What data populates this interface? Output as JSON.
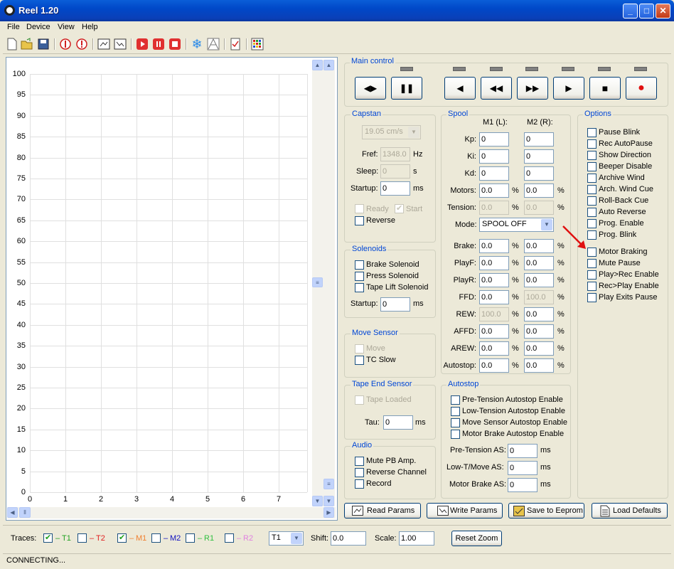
{
  "window": {
    "title": "Reel 1.20"
  },
  "menu": [
    "File",
    "Device",
    "View",
    "Help"
  ],
  "graph": {
    "y_ticks": [
      "100",
      "95",
      "90",
      "85",
      "80",
      "75",
      "70",
      "65",
      "60",
      "55",
      "50",
      "45",
      "40",
      "35",
      "30",
      "25",
      "20",
      "15",
      "10",
      "5",
      "0"
    ],
    "x_ticks": [
      "0",
      "1",
      "2",
      "3",
      "4",
      "5",
      "6",
      "7"
    ]
  },
  "main_control": {
    "title": "Main control"
  },
  "capstan": {
    "title": "Capstan",
    "speed": "19.05 cm/s",
    "fref_label": "Fref:",
    "fref_value": "1348.0",
    "fref_unit": "Hz",
    "sleep_label": "Sleep:",
    "sleep_value": "0",
    "sleep_unit": "s",
    "startup_label": "Startup:",
    "startup_value": "0",
    "startup_unit": "ms",
    "ready": "Ready",
    "start": "Start",
    "reverse": "Reverse"
  },
  "solenoids": {
    "title": "Solenoids",
    "brake": "Brake Solenoid",
    "press": "Press Solenoid",
    "tape_lift": "Tape Lift Solenoid",
    "startup_label": "Startup:",
    "startup_value": "0",
    "startup_unit": "ms"
  },
  "move_sensor": {
    "title": "Move Sensor",
    "move": "Move",
    "tc_slow": "TC Slow"
  },
  "tape_end": {
    "title": "Tape End Sensor",
    "tape_loaded": "Tape Loaded",
    "tau_label": "Tau:",
    "tau_value": "0",
    "tau_unit": "ms"
  },
  "audio": {
    "title": "Audio",
    "mute": "Mute PB Amp.",
    "reverse": "Reverse Channel",
    "record": "Record"
  },
  "spool": {
    "title": "Spool",
    "m1": "M1 (L):",
    "m2": "M2 (R):",
    "kp": "Kp:",
    "ki": "Ki:",
    "kd": "Kd:",
    "kp1": "0",
    "kp2": "0",
    "ki1": "0",
    "ki2": "0",
    "kd1": "0",
    "kd2": "0",
    "motors": "Motors:",
    "motors1": "0.0",
    "motors2": "0.0",
    "tension": "Tension:",
    "tension1": "0.0",
    "tension2": "0.0",
    "mode": "Mode:",
    "mode_value": "SPOOL OFF",
    "brake": "Brake:",
    "brake1": "0.0",
    "brake2": "0.0",
    "playf": "PlayF:",
    "playf1": "0.0",
    "playf2": "0.0",
    "playr": "PlayR:",
    "playr1": "0.0",
    "playr2": "0.0",
    "ffd": "FFD:",
    "ffd1": "0.0",
    "ffd2": "100.0",
    "rew": "REW:",
    "rew1": "100.0",
    "rew2": "0.0",
    "affd": "AFFD:",
    "affd1": "0.0",
    "affd2": "0.0",
    "arew": "AREW:",
    "arew1": "0.0",
    "arew2": "0.0",
    "autostop": "Autostop:",
    "autostop1": "0.0",
    "autostop2": "0.0",
    "pct": "%"
  },
  "autostop": {
    "title": "Autostop",
    "pre_tension": "Pre-Tension Autostop Enable",
    "low_tension": "Low-Tension Autostop Enable",
    "move_sensor": "Move Sensor Autostop Enable",
    "motor_brake": "Motor Brake Autostop Enable",
    "pre_as_label": "Pre-Tension AS:",
    "pre_as_value": "0",
    "low_as_label": "Low-T/Move AS:",
    "low_as_value": "0",
    "brake_as_label": "Motor Brake AS:",
    "brake_as_value": "0",
    "unit": "ms"
  },
  "options": {
    "title": "Options",
    "items": [
      "Pause Blink",
      "Rec AutoPause",
      "Show Direction",
      "Beeper Disable",
      "Archive Wind",
      "Arch. Wind Cue",
      "Roll-Back Cue",
      "Auto Reverse",
      "Prog. Enable",
      "Prog. Blink",
      "Motor Braking",
      "Mute Pause",
      "Play>Rec Enable",
      "Rec>Play Enable",
      "Play Exits Pause"
    ]
  },
  "buttons": {
    "read": "Read Params",
    "write": "Write Params",
    "save": "Save to Eeprom",
    "load": "Load Defaults"
  },
  "traces": {
    "label": "Traces:",
    "items": [
      {
        "name": "T1",
        "color": "#21a121"
      },
      {
        "name": "T2",
        "color": "#e02020"
      },
      {
        "name": "M1",
        "color": "#f08030"
      },
      {
        "name": "M2",
        "color": "#1010c0"
      },
      {
        "name": "R1",
        "color": "#30c040"
      },
      {
        "name": "R2",
        "color": "#e080e0"
      }
    ],
    "select": "T1",
    "shift_label": "Shift:",
    "shift_value": "0.0",
    "scale_label": "Scale:",
    "scale_value": "1.00",
    "reset": "Reset Zoom"
  },
  "status": "CONNECTING..."
}
